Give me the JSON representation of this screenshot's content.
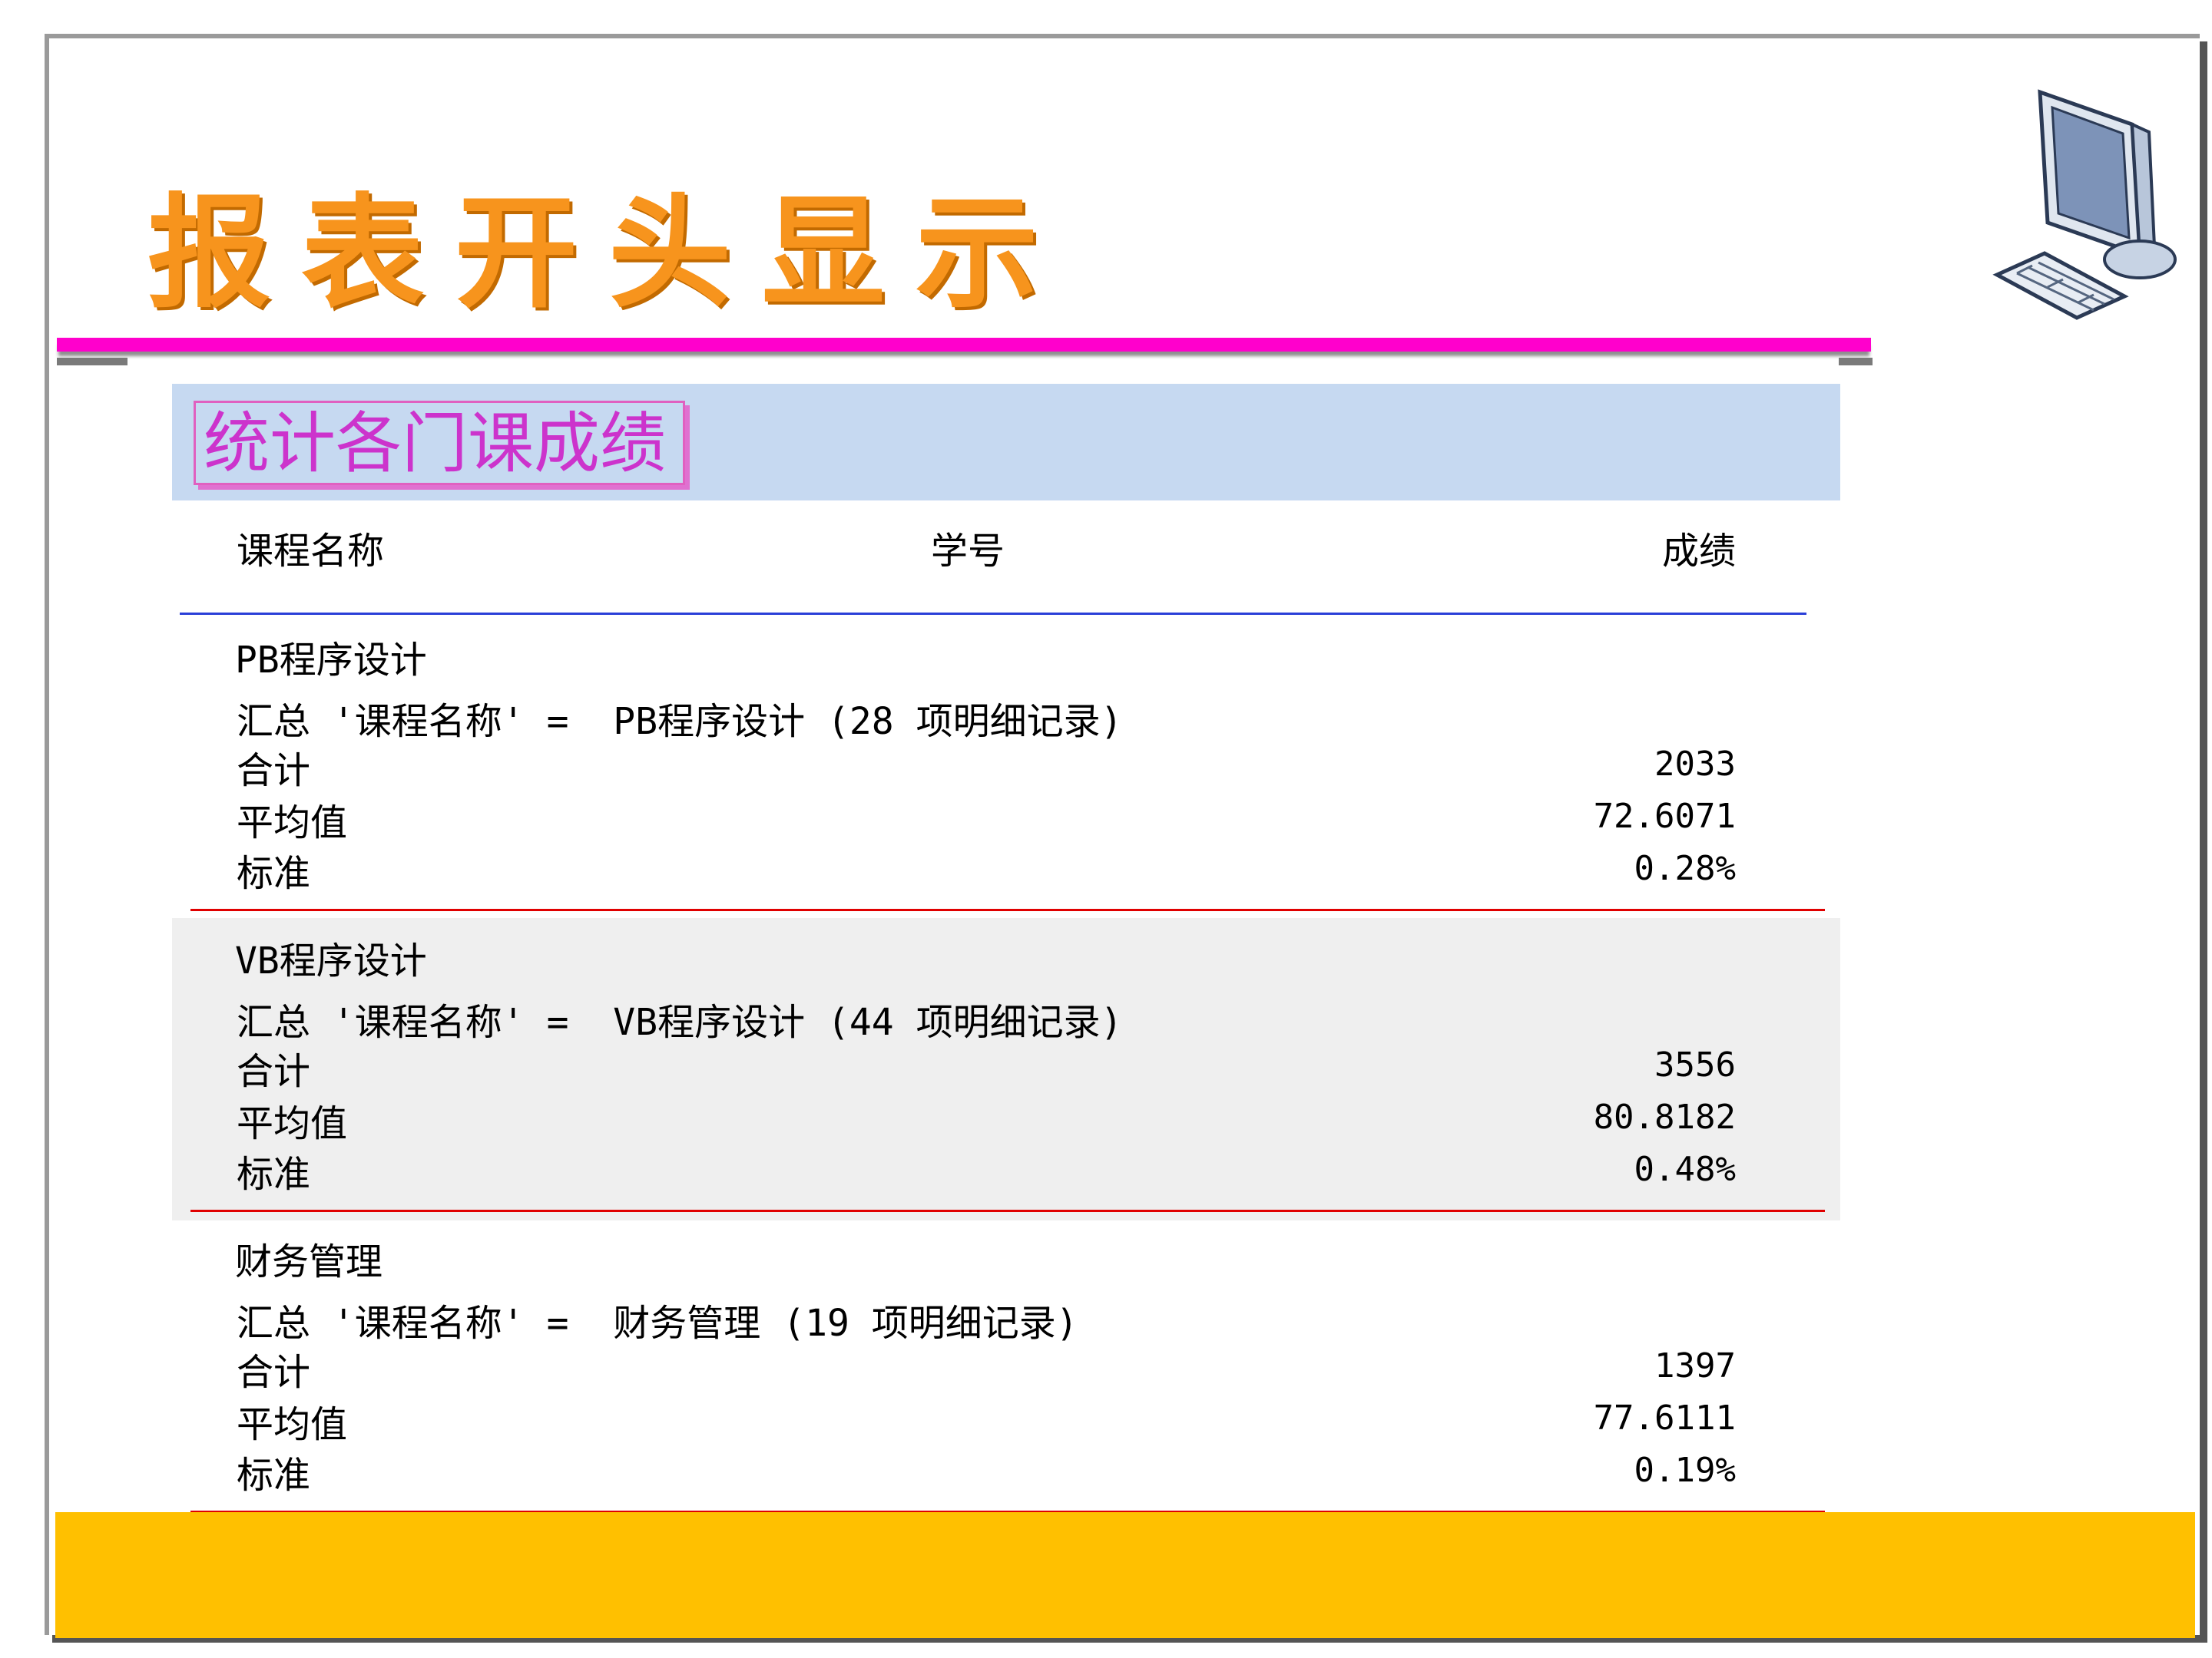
{
  "slide": {
    "title": "报表开头显示",
    "accent_colors": {
      "title": "#f7941d",
      "title_bar": "#ff00cc",
      "report_header_bg": "#c6d9f1",
      "group_rule": "#e00000",
      "header_rule": "#2a3fd8",
      "footer_band": "#ffc000"
    },
    "decor_icon": "computer-icon"
  },
  "report": {
    "title": "统计各门课成绩",
    "columns": {
      "course": "课程名称",
      "student_id": "学号",
      "score": "成绩"
    },
    "groups": [
      {
        "name": "PB程序设计",
        "summary": "汇总 '课程名称' =  PB程序设计 (28 项明细记录)",
        "stats": [
          {
            "label": "合计",
            "value": "2033"
          },
          {
            "label": "平均值",
            "value": "72.6071"
          },
          {
            "label": "标准",
            "value": "0.28%"
          }
        ]
      },
      {
        "name": "VB程序设计",
        "summary": "汇总 '课程名称' =  VB程序设计 (44 项明细记录)",
        "stats": [
          {
            "label": "合计",
            "value": "3556"
          },
          {
            "label": "平均值",
            "value": "80.8182"
          },
          {
            "label": "标准",
            "value": "0.48%"
          }
        ]
      },
      {
        "name": "财务管理",
        "summary": "汇总 '课程名称' =  财务管理 (19 项明细记录)",
        "stats": [
          {
            "label": "合计",
            "value": "1397"
          },
          {
            "label": "平均值",
            "value": "77.6111"
          },
          {
            "label": "标准",
            "value": "0.19%"
          }
        ]
      }
    ]
  }
}
